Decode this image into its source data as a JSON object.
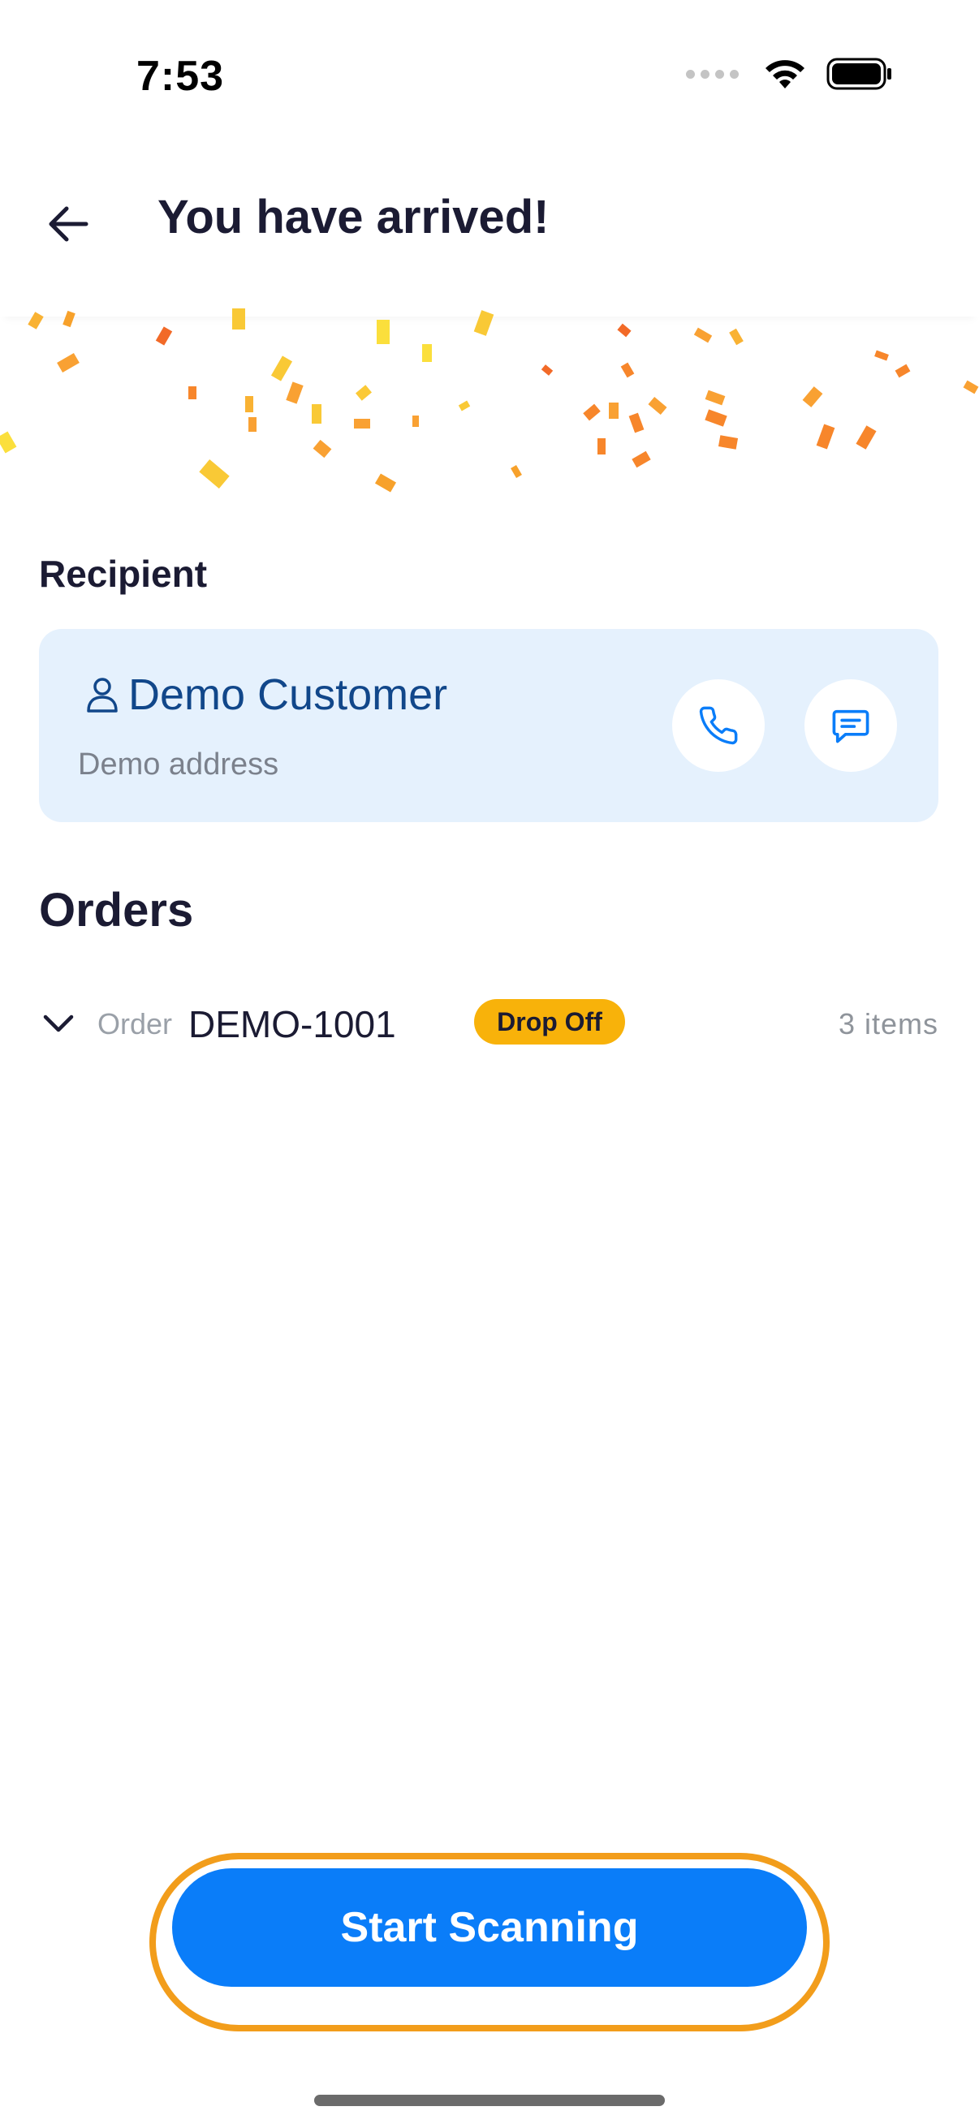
{
  "status_bar": {
    "time": "7:53"
  },
  "header": {
    "title": "You have arrived!"
  },
  "recipient": {
    "section_label": "Recipient",
    "name": "Demo Customer",
    "address": "Demo address"
  },
  "orders": {
    "title": "Orders",
    "items": [
      {
        "label": "Order",
        "id": "DEMO-1001",
        "badge": "Drop Off",
        "count": "3 items"
      }
    ]
  },
  "primary_action": {
    "label": "Start Scanning"
  },
  "colors": {
    "accent": "#0a7df9",
    "badge": "#f8b20a",
    "focus_ring": "#f29d1b",
    "card_bg": "#e5f1fd",
    "name_text": "#11478a"
  },
  "icons": {
    "back": "arrow-left-icon",
    "person": "person-icon",
    "call": "phone-icon",
    "message": "message-icon",
    "expand": "chevron-down-icon",
    "wifi": "wifi-icon",
    "battery": "battery-icon",
    "signal": "signal-icon"
  }
}
